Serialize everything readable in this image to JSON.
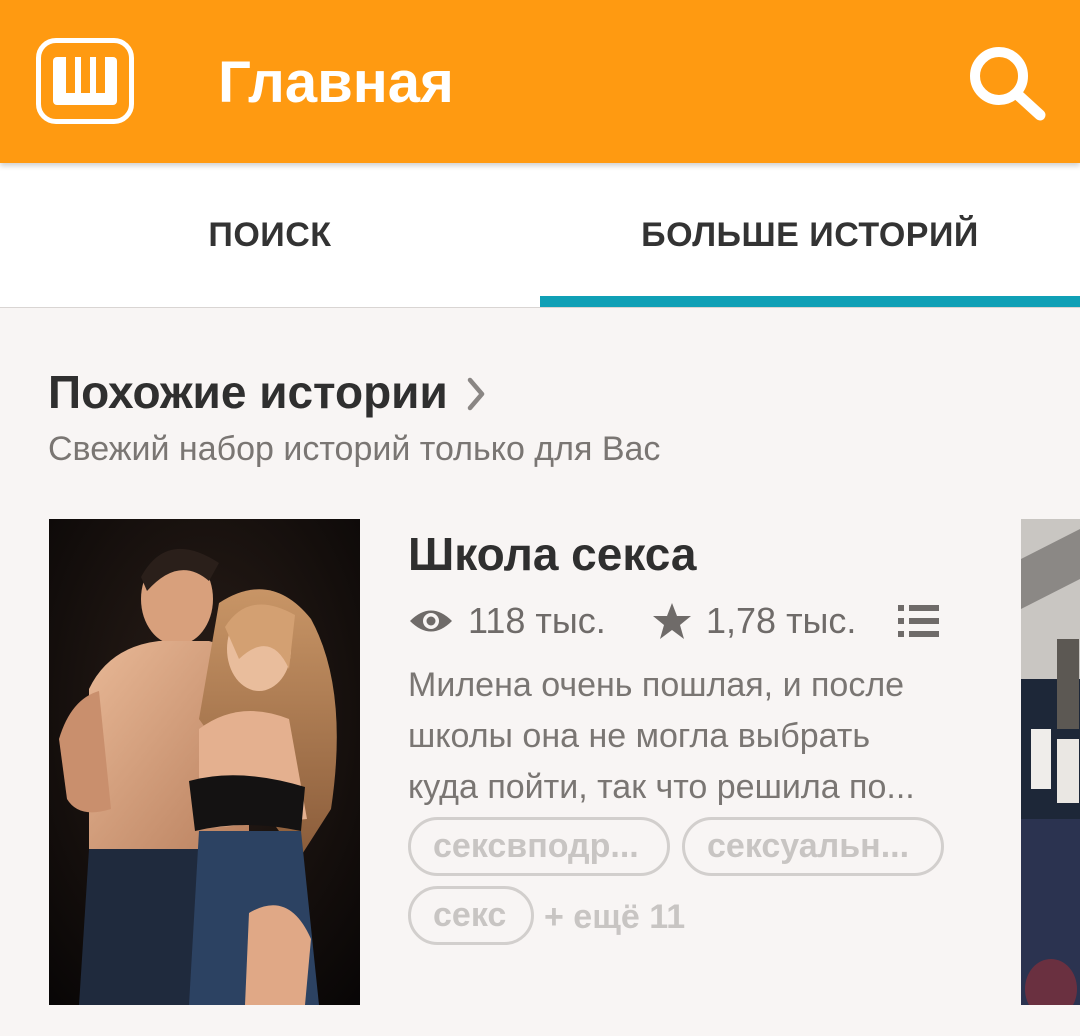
{
  "app": {
    "title": "Главная",
    "brand_color": "#ff9a11",
    "accent_color": "#10a0b6",
    "logo_icon": "wattpad-w-logo-icon",
    "search_icon": "search-icon"
  },
  "tabs": [
    {
      "label": "ПОИСК",
      "selected": false
    },
    {
      "label": "БОЛЬШЕ ИСТОРИЙ",
      "selected": true
    }
  ],
  "section": {
    "title": "Похожие истории",
    "subtitle": "Свежий набор историй только для Вас"
  },
  "story": {
    "title": "Школа секса",
    "views": "118 тыс.",
    "votes": "1,78 тыс.",
    "description_lines": [
      "Милена очень пошлая, и после",
      "школы она не могла выбрать",
      "куда пойти, так что решила по..."
    ],
    "tags": [
      "сексвподр...",
      "сексуальн...",
      "секс"
    ],
    "more_tags": "+ ещё 11"
  }
}
